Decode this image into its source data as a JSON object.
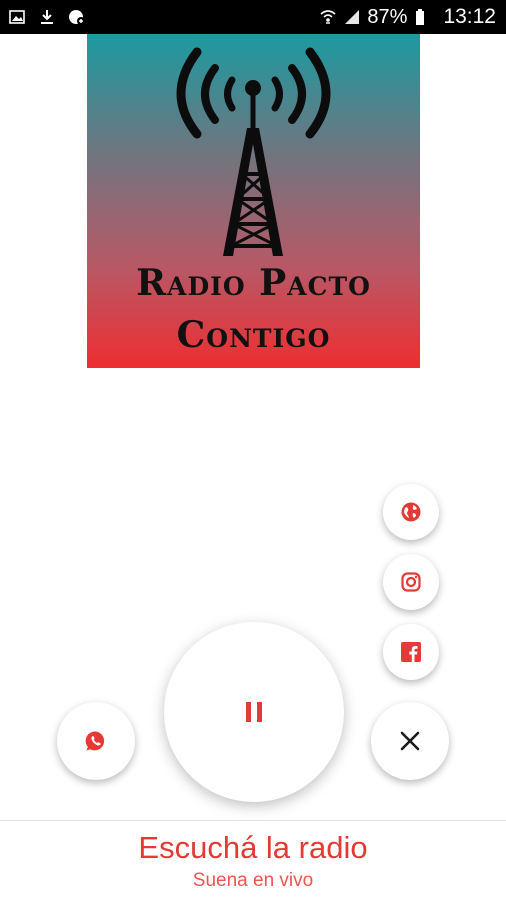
{
  "status_bar": {
    "left_icons": [
      "image-icon",
      "download-icon",
      "app-notification-icon"
    ],
    "right_icons": [
      "wifi-icon",
      "signal-icon"
    ],
    "battery": "87%",
    "time": "13:12"
  },
  "cover": {
    "line1": "Radio Pacto",
    "line2": "Contigo"
  },
  "actions": {
    "website_icon": "globe-icon",
    "instagram_icon": "instagram-icon",
    "facebook_icon": "facebook-icon",
    "close_icon": "close-icon",
    "whatsapp_icon": "whatsapp-icon",
    "play_state_icon": "pause-icon"
  },
  "now_playing": {
    "title": "Escuchá la radio",
    "subtitle": "Suena en vivo"
  },
  "colors": {
    "accent": "#e53935",
    "cover_top": "#1b9aa0",
    "cover_bottom": "#ee2e31"
  }
}
